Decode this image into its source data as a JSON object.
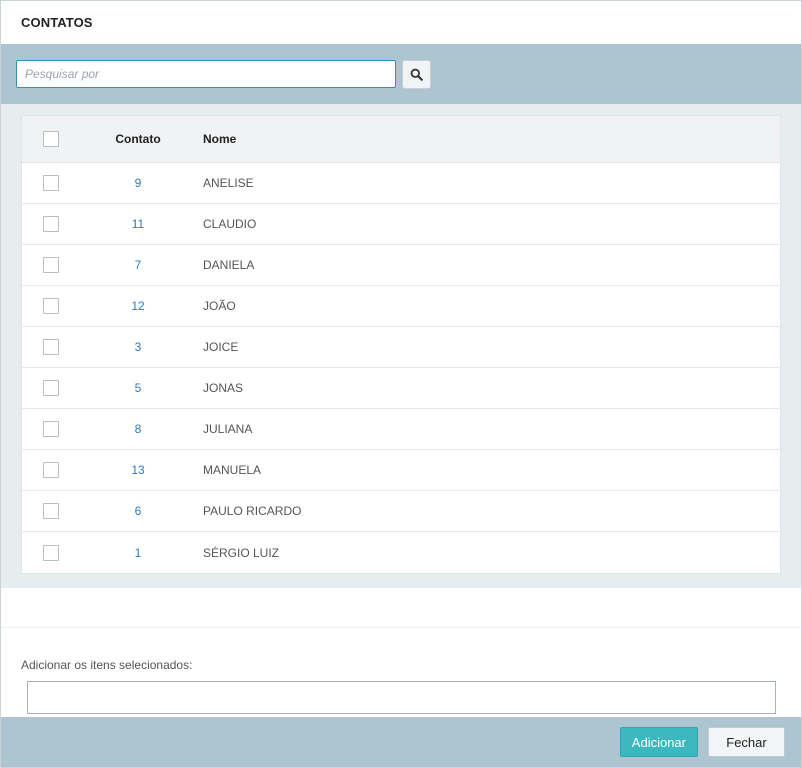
{
  "modal": {
    "title": "CONTATOS"
  },
  "search": {
    "placeholder": "Pesquisar por",
    "value": "",
    "icon": "search-icon"
  },
  "grid": {
    "headers": {
      "contato": "Contato",
      "nome": "Nome"
    },
    "rows": [
      {
        "contato": "9",
        "nome": "ANELISE"
      },
      {
        "contato": "11",
        "nome": "CLAUDIO"
      },
      {
        "contato": "7",
        "nome": "DANIELA"
      },
      {
        "contato": "12",
        "nome": "JOÃO"
      },
      {
        "contato": "3",
        "nome": "JOICE"
      },
      {
        "contato": "5",
        "nome": "JONAS"
      },
      {
        "contato": "8",
        "nome": "JULIANA"
      },
      {
        "contato": "13",
        "nome": "MANUELA"
      },
      {
        "contato": "6",
        "nome": "PAULO RICARDO"
      },
      {
        "contato": "1",
        "nome": "SÉRGIO LUIZ"
      }
    ]
  },
  "selected": {
    "label": "Adicionar os itens selecionados:",
    "value": ""
  },
  "footer": {
    "add_label": "Adicionar",
    "close_label": "Fechar"
  },
  "colors": {
    "accent": "#3cb7c0",
    "bar": "#adc5d1",
    "link": "#2f7bb8"
  }
}
